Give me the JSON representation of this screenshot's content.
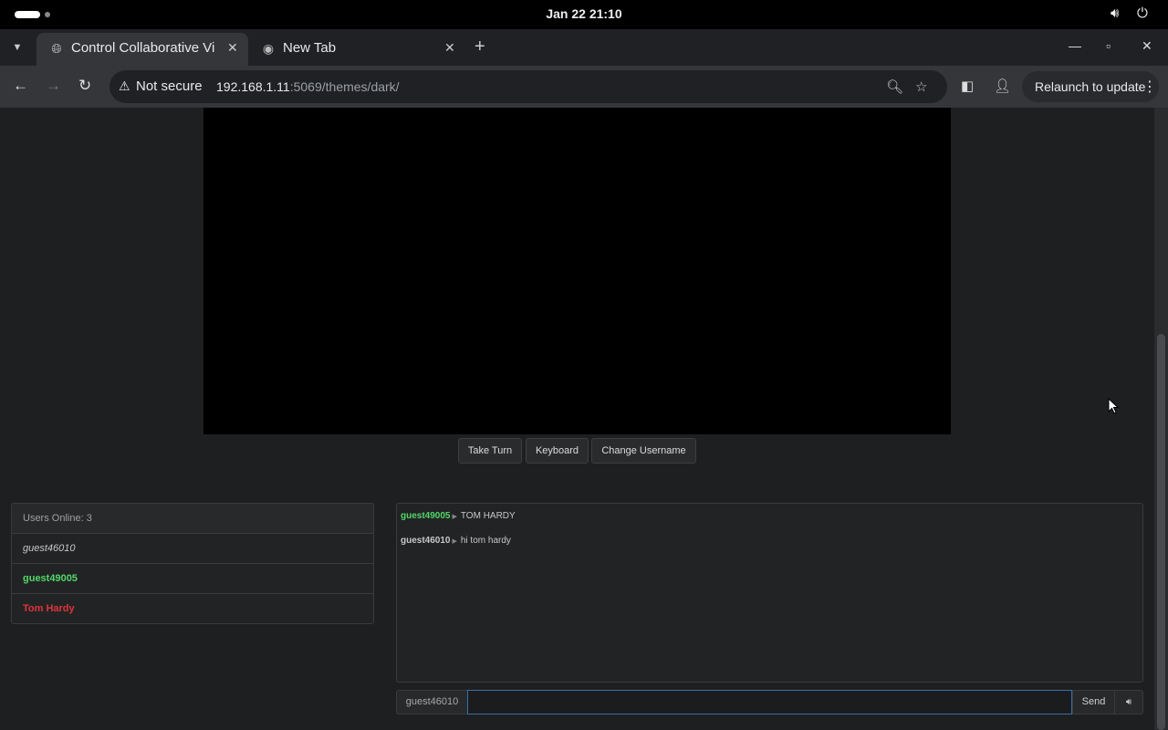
{
  "system_bar": {
    "clock": "Jan 22  21:10",
    "icons": [
      "volume-icon",
      "power-icon"
    ]
  },
  "browser": {
    "tabs": [
      {
        "title": "Control Collaborative Vi",
        "icon": "globe-icon",
        "active": true
      },
      {
        "title": "New Tab",
        "icon": "chrome-icon",
        "active": false
      }
    ],
    "security_label": "Not secure",
    "url_host": "192.168.1.11",
    "url_path": ":5069/themes/dark/",
    "relaunch_label": "Relaunch to update"
  },
  "controls": {
    "take_turn": "Take Turn",
    "keyboard": "Keyboard",
    "change_username": "Change Username"
  },
  "users": {
    "header": "Users Online: 3",
    "list": [
      {
        "name": "guest46010",
        "style": "self"
      },
      {
        "name": "guest49005",
        "style": "green"
      },
      {
        "name": "Tom Hardy",
        "style": "red"
      }
    ]
  },
  "chat": {
    "messages": [
      {
        "user": "guest49005",
        "text": "TOM HARDY",
        "color": "#53d769"
      },
      {
        "user": "guest46010",
        "text": "hi tom hardy",
        "color": "#c8c8c8"
      }
    ],
    "current_user": "guest46010",
    "input_value": "",
    "send_label": "Send"
  }
}
